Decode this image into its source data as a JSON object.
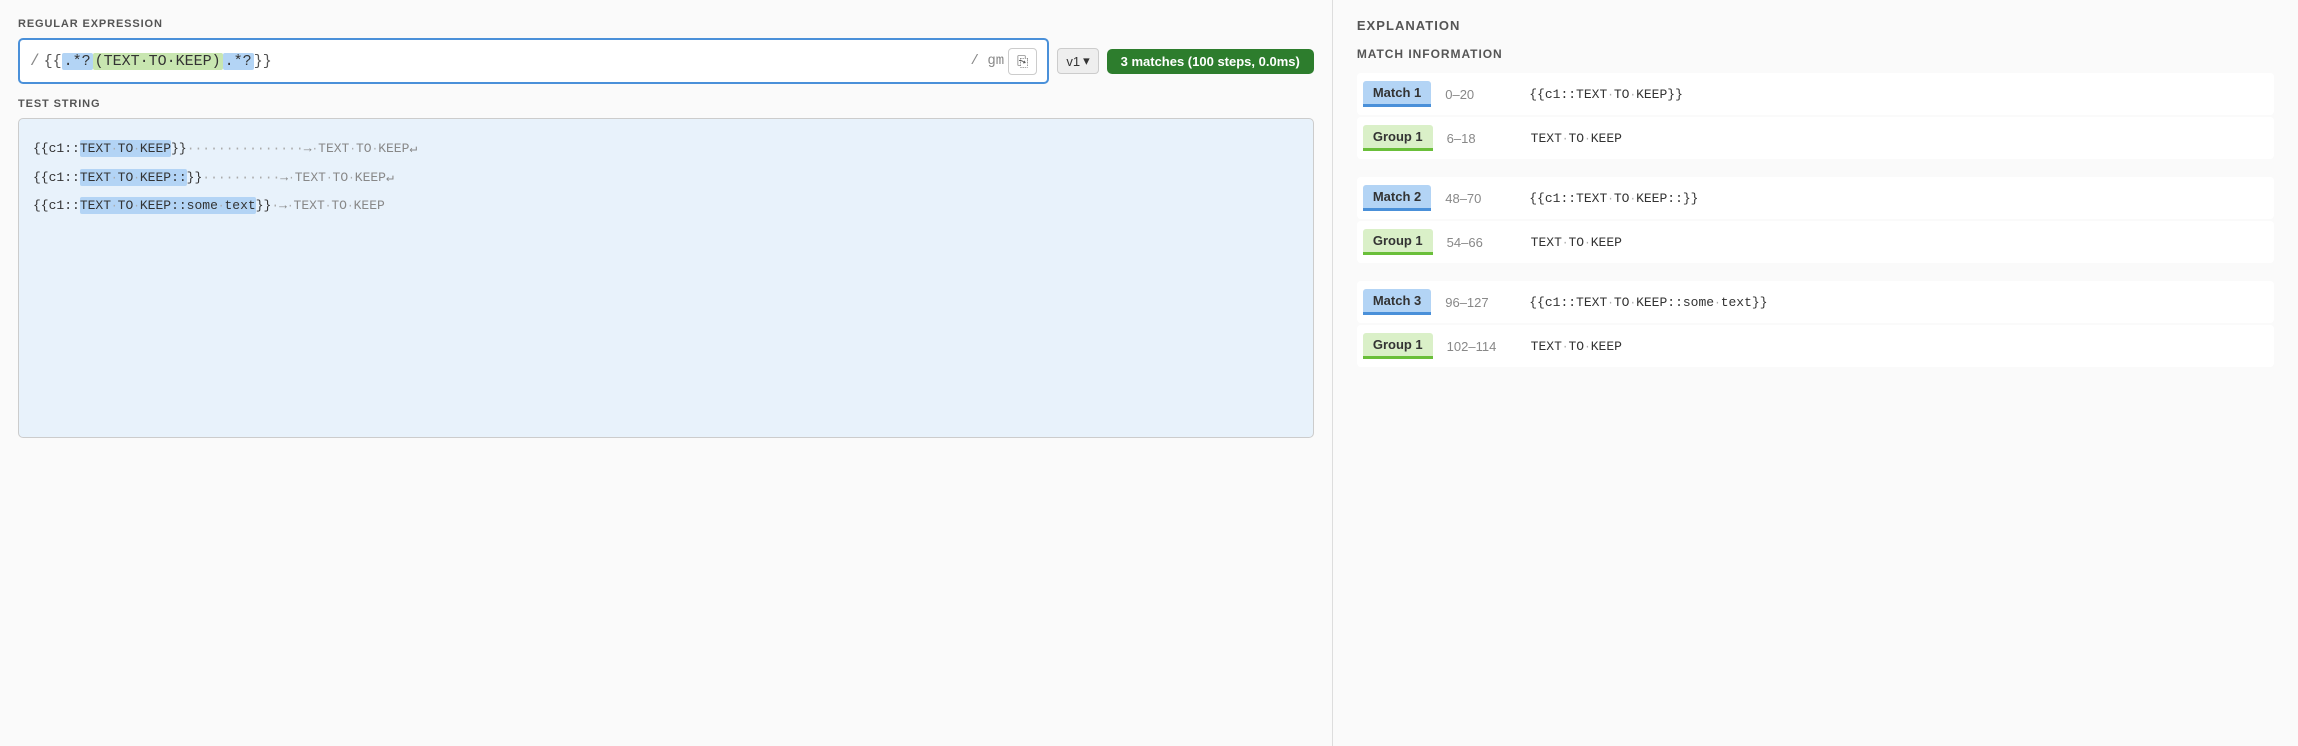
{
  "left": {
    "regex_label": "REGULAR EXPRESSION",
    "regex_prefix": "/",
    "regex_raw": "{{.\\*?(TEXT TO KEEP).\\*?}}",
    "regex_flags": "/ gm",
    "version_label": "v1",
    "version_chevron": "▾",
    "match_badge": "3 matches (100 steps, 0.0ms)",
    "copy_icon": "⎘",
    "test_label": "TEST STRING",
    "lines": [
      {
        "id": "line1",
        "parts": [
          {
            "type": "text",
            "val": "{{c1::"
          },
          {
            "type": "hl_blue",
            "val": "TEXT·TO·KEEP"
          },
          {
            "type": "text",
            "val": "}}"
          },
          {
            "type": "dots",
            "val": "···············"
          },
          {
            "type": "arrow",
            "val": "→·TEXT·TO·KEEP↵"
          }
        ]
      },
      {
        "id": "line2",
        "parts": [
          {
            "type": "text",
            "val": "{{c1::"
          },
          {
            "type": "hl_blue",
            "val": "TEXT·TO·KEEP::"
          },
          {
            "type": "text",
            "val": "}}"
          },
          {
            "type": "dots",
            "val": "··········"
          },
          {
            "type": "arrow",
            "val": "→·TEXT·TO·KEEP↵"
          }
        ]
      },
      {
        "id": "line3",
        "parts": [
          {
            "type": "text",
            "val": "{{c1::"
          },
          {
            "type": "hl_blue",
            "val": "TEXT·TO·KEEP::some·text"
          },
          {
            "type": "text",
            "val": "}}"
          },
          {
            "type": "dots",
            "val": "·"
          },
          {
            "type": "arrow",
            "val": "→·TEXT·TO·KEEP"
          }
        ]
      }
    ]
  },
  "right": {
    "explanation_title": "EXPLANATION",
    "match_info_title": "MATCH INFORMATION",
    "matches": [
      {
        "match_label": "Match 1",
        "match_range": "0–20",
        "match_value": "{{c1::TEXT·TO·KEEP}}",
        "group_label": "Group 1",
        "group_range": "6–18",
        "group_value": "TEXT·TO·KEEP"
      },
      {
        "match_label": "Match 2",
        "match_range": "48–70",
        "match_value": "{{c1::TEXT·TO·KEEP::}}",
        "group_label": "Group 1",
        "group_range": "54–66",
        "group_value": "TEXT·TO·KEEP"
      },
      {
        "match_label": "Match 3",
        "match_range": "96–127",
        "match_value": "{{c1::TEXT·TO·KEEP::some·text}}",
        "group_label": "Group 1",
        "group_range": "102–114",
        "group_value": "TEXT·TO·KEEP"
      }
    ]
  }
}
